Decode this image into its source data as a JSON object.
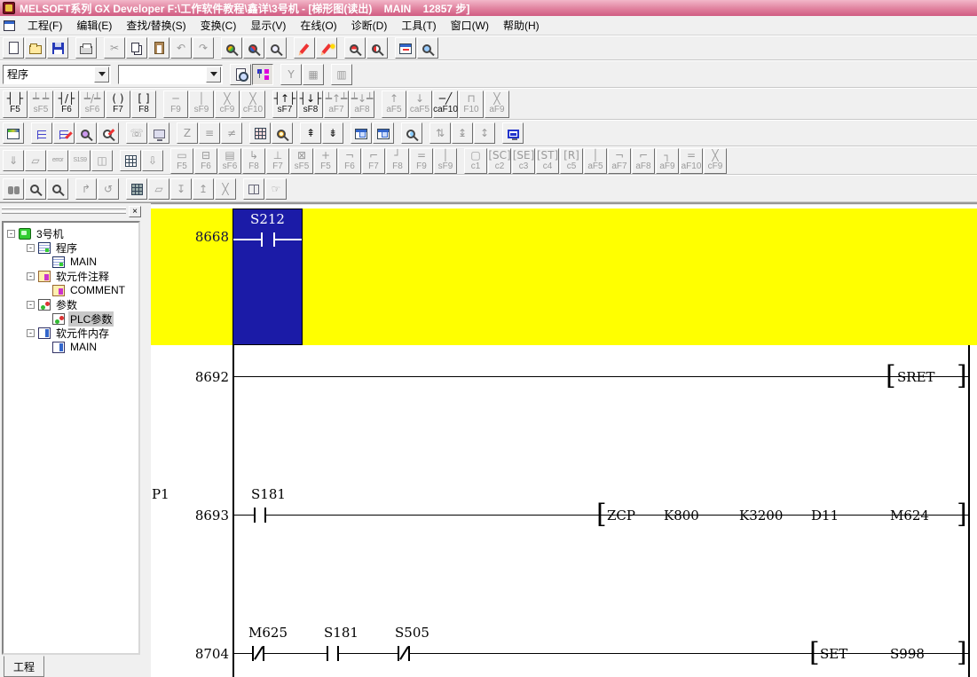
{
  "colors": {
    "titlebar_top": "#f2b7c9",
    "titlebar_mid": "#e0819e",
    "titlebar_bottom": "#d05c82",
    "end_yellow": "#ffff00",
    "selection_blue": "#1b1ba7",
    "tree_selected_bg": "#c8c8c8"
  },
  "title_bar": {
    "title": "MELSOFT系列 GX Developer F:\\工作软件教程\\鑫详\\3号机 - [梯形图(读出)    MAIN    12857 步]"
  },
  "menu": {
    "items": [
      "工程(F)",
      "编辑(E)",
      "查找/替换(S)",
      "变换(C)",
      "显示(V)",
      "在线(O)",
      "诊断(D)",
      "工具(T)",
      "窗口(W)",
      "帮助(H)"
    ]
  },
  "toolbars": {
    "row1": [
      {
        "name": "new-project-button",
        "cls": "i-page"
      },
      {
        "name": "open-project-button",
        "cls": "i-folder"
      },
      {
        "name": "save-project-button",
        "cls": "i-disk"
      },
      {
        "name": "print-button",
        "btncls": "sep",
        "cls": "i-printer"
      },
      {
        "name": "cut-button",
        "btncls": "gray sep",
        "cls": "i-glyph",
        "glyph": "✂"
      },
      {
        "name": "copy-button",
        "cls": "i-copy"
      },
      {
        "name": "paste-button",
        "btncls": "gray",
        "cls": "i-paste"
      },
      {
        "name": "undo-button",
        "btncls": "gray",
        "cls": "i-glyph",
        "glyph": "↶"
      },
      {
        "name": "redo-button",
        "btncls": "gray",
        "cls": "i-glyph",
        "glyph": "↷"
      },
      {
        "name": "find-device-button",
        "btncls": "sep",
        "cls": "i-mag mag-color"
      },
      {
        "name": "find-instruction-button",
        "cls": "i-mag mag-tri"
      },
      {
        "name": "find-string-button",
        "cls": "i-mag mag-abc"
      },
      {
        "name": "device-comment-edit-button",
        "btncls": "sep",
        "cls": "i-pencil"
      },
      {
        "name": "statement-edit-button",
        "cls": "i-pencil pencil-star"
      },
      {
        "name": "device-test-button",
        "btncls": "sep",
        "cls": "i-mag mag-dev"
      },
      {
        "name": "device-batch-monitor-button",
        "cls": "i-mag mag-dev2"
      },
      {
        "name": "transfer-setup-button",
        "btncls": "sep",
        "cls": "i-window win-transfer"
      },
      {
        "name": "program-monitor-button",
        "cls": "i-mag mag-check"
      }
    ],
    "program_combo_value": "程序",
    "find_combo_value": "",
    "row2_buttons": [
      {
        "name": "statement-list-button",
        "cls": "i-page page-mag"
      },
      {
        "name": "project-data-list-button",
        "btncls": "pressed",
        "cls": "i-tree"
      },
      {
        "name": "instruction-list-button",
        "btncls": "gray sep",
        "cls": "i-glyph",
        "glyph": "Y"
      },
      {
        "name": "device-use-list-button",
        "btncls": "gray",
        "cls": "i-glyph",
        "glyph": "▦"
      },
      {
        "name": "check-program-button",
        "btncls": "gray sep",
        "cls": "i-glyph",
        "glyph": "▥"
      }
    ],
    "row3": [
      {
        "name": "open-contact-button",
        "sym": "┤ ├",
        "label": "F5"
      },
      {
        "name": "parallel-open-contact-button",
        "btncls": "gray",
        "sym": "┷ ┷",
        "label": "sF5"
      },
      {
        "name": "closed-contact-button",
        "sym": "┤/├",
        "label": "F6"
      },
      {
        "name": "parallel-closed-contact-button",
        "btncls": "gray",
        "sym": "┷/┷",
        "label": "sF6"
      },
      {
        "name": "coil-button",
        "sym": "( )",
        "label": "F7"
      },
      {
        "name": "application-instruction-button",
        "sym": "[ ]",
        "label": "F8"
      },
      {
        "name": "horizontal-line-button",
        "btncls": "gray sep",
        "sym": "─",
        "label": "F9"
      },
      {
        "name": "vertical-line-button",
        "btncls": "gray",
        "sym": "│",
        "label": "sF9"
      },
      {
        "name": "delete-horizontal-line-button",
        "btncls": "gray",
        "sym": "╳",
        "label": "cF9"
      },
      {
        "name": "delete-vertical-line-button",
        "btncls": "gray",
        "sym": "╳",
        "label": "cF10"
      },
      {
        "name": "rising-pulse-button",
        "btncls": "sep",
        "sym": "┤↑├",
        "label": "sF7"
      },
      {
        "name": "falling-pulse-button",
        "sym": "┤↓├",
        "label": "sF8"
      },
      {
        "name": "parallel-rising-pulse-button",
        "btncls": "gray",
        "sym": "┷↑┷",
        "label": "aF7"
      },
      {
        "name": "parallel-falling-pulse-button",
        "btncls": "gray",
        "sym": "┷↓┷",
        "label": "aF8"
      },
      {
        "name": "rising-result-button",
        "btncls": "gray sep",
        "sym": "↑",
        "label": "aF5"
      },
      {
        "name": "falling-result-button",
        "btncls": "gray",
        "sym": "↓",
        "label": "caF5"
      },
      {
        "name": "invert-operation-button",
        "sym": "─╱",
        "label": "caF10"
      },
      {
        "name": "line-edit-button",
        "btncls": "gray",
        "sym": "⊓",
        "label": "F10"
      },
      {
        "name": "delete-line-button",
        "btncls": "gray",
        "sym": "╳",
        "label": "aF9"
      }
    ],
    "row4": [
      {
        "name": "ladder-logic-test-button",
        "cls": "i-window win-colored"
      },
      {
        "name": "comment-display-button",
        "btncls": "sep",
        "cls": "i-treelines"
      },
      {
        "name": "statement-display-button",
        "cls": "i-treelines tl-pencil"
      },
      {
        "name": "alias-display-button",
        "cls": "i-mag mag-purple"
      },
      {
        "name": "alias-edit-button",
        "cls": "i-mag mag-pencil"
      },
      {
        "name": "remote-operation-button",
        "btncls": "gray sep",
        "cls": "i-glyph",
        "glyph": "☏"
      },
      {
        "name": "monitor-test-button",
        "btncls": "gray",
        "cls": "i-monitor"
      },
      {
        "name": "sampling-trace-button",
        "btncls": "gray sep",
        "cls": "i-glyph",
        "glyph": "Z"
      },
      {
        "name": "entry-ladder-monitor-button",
        "btncls": "gray",
        "cls": "i-glyph",
        "glyph": "≡"
      },
      {
        "name": "delete-ladder-button",
        "btncls": "gray",
        "cls": "i-glyph",
        "glyph": "≠"
      },
      {
        "name": "device-memory-button",
        "btncls": "sep",
        "cls": "i-grid grid-color"
      },
      {
        "name": "clock-setting-button",
        "cls": "i-mag mag-clock"
      },
      {
        "name": "collapse-all-button",
        "btncls": "sep",
        "cls": "i-glyph",
        "glyph": "⇞"
      },
      {
        "name": "expand-all-button",
        "cls": "i-glyph",
        "glyph": "⇟"
      },
      {
        "name": "open-window-button",
        "btncls": "sep",
        "cls": "i-window win-arrow"
      },
      {
        "name": "open-reference-window-button",
        "cls": "i-window win-arrow2"
      },
      {
        "name": "online-program-change-button",
        "btncls": "sep",
        "cls": "i-mag mag-globe"
      },
      {
        "name": "insert-row-above-button",
        "btncls": "gray sep",
        "cls": "i-glyph",
        "glyph": "⇅"
      },
      {
        "name": "insert-row-below-button",
        "btncls": "gray",
        "cls": "i-glyph",
        "glyph": "↨"
      },
      {
        "name": "delete-row-button",
        "btncls": "gray",
        "cls": "i-glyph",
        "glyph": "↕"
      },
      {
        "name": "ladder-monitor-button",
        "btncls": "sep",
        "cls": "i-monitor mon-blue"
      }
    ],
    "row5_left": [
      {
        "name": "step-execute-button",
        "btncls": "gray",
        "cls": "i-glyph",
        "glyph": "⇓"
      },
      {
        "name": "cascade-windows-button",
        "btncls": "gray",
        "cls": "i-glyph",
        "glyph": "▱"
      },
      {
        "name": "error-list-button",
        "btncls": "gray",
        "cls": "i-error",
        "glyph": "error"
      },
      {
        "name": "step-number-button",
        "btncls": "gray",
        "cls": "i-error",
        "glyph": "S1S9"
      },
      {
        "name": "block-list-button",
        "btncls": "gray",
        "cls": "i-glyph",
        "glyph": "◫"
      },
      {
        "name": "sfc-grid-button",
        "btncls": "sep",
        "cls": "i-grid"
      },
      {
        "name": "block-down-button",
        "btncls": "gray",
        "cls": "i-glyph",
        "glyph": "⇩"
      }
    ],
    "row5_sfc": [
      {
        "name": "sfc-step-button",
        "btncls": "gray sep",
        "sym": "▭",
        "label": "F5"
      },
      {
        "name": "sfc-block-start-step-button",
        "btncls": "gray",
        "sym": "⊟",
        "label": "F6"
      },
      {
        "name": "sfc-end-step-button",
        "btncls": "gray",
        "sym": "▤",
        "label": "sF6"
      },
      {
        "name": "sfc-jump-button",
        "btncls": "gray",
        "sym": "↳",
        "label": "F8"
      },
      {
        "name": "sfc-transition-button",
        "btncls": "gray",
        "sym": "⊥",
        "label": "F7"
      },
      {
        "name": "sfc-dummy-step-button",
        "btncls": "gray",
        "sym": "⊠",
        "label": "sF5"
      },
      {
        "name": "sfc-vertical-line-button",
        "btncls": "gray",
        "sym": "+",
        "label": "F5"
      },
      {
        "name": "sfc-selection-divergence-button",
        "btncls": "gray",
        "sym": "¬",
        "label": "F6"
      },
      {
        "name": "sfc-simultaneous-divergence-button",
        "btncls": "gray",
        "sym": "⌐",
        "label": "F7"
      },
      {
        "name": "sfc-selection-convergence-button",
        "btncls": "gray",
        "sym": "┘",
        "label": "F8"
      },
      {
        "name": "sfc-simultaneous-convergence-button",
        "btncls": "gray",
        "sym": "=",
        "label": "F9"
      },
      {
        "name": "sfc-line-button",
        "btncls": "gray",
        "sym": "│",
        "label": "sF9"
      }
    ],
    "row5_c": [
      {
        "name": "sfc-c1-button",
        "btncls": "gray sep",
        "sym": "▢",
        "label": "c1"
      },
      {
        "name": "sfc-sc-button",
        "btncls": "gray",
        "sym": "[SC]",
        "label": "c2"
      },
      {
        "name": "sfc-se-button",
        "btncls": "gray",
        "sym": "[SE]",
        "label": "c3"
      },
      {
        "name": "sfc-st-button",
        "btncls": "gray",
        "sym": "[ST]",
        "label": "c4"
      },
      {
        "name": "sfc-r-button",
        "btncls": "gray",
        "sym": "[R]",
        "label": "c5"
      },
      {
        "name": "sfc-af5-button",
        "btncls": "gray",
        "sym": "│",
        "label": "aF5"
      },
      {
        "name": "sfc-af7-button",
        "btncls": "gray",
        "sym": "¬",
        "label": "aF7"
      },
      {
        "name": "sfc-af8-button",
        "btncls": "gray",
        "sym": "⌐",
        "label": "aF8"
      },
      {
        "name": "sfc-af9-button",
        "btncls": "gray",
        "sym": "┐",
        "label": "aF9"
      },
      {
        "name": "sfc-af10-button",
        "btncls": "gray",
        "sym": "=",
        "label": "aF10"
      },
      {
        "name": "sfc-delete-button",
        "btncls": "gray",
        "sym": "╳",
        "label": "cF9"
      }
    ],
    "row6": [
      {
        "name": "find-button",
        "btncls": "gray",
        "cls": "i-binoc"
      },
      {
        "name": "find-next-button",
        "btncls": "gray",
        "cls": "i-mag mag-down"
      },
      {
        "name": "find-previous-button",
        "btncls": "gray",
        "cls": "i-mag mag-up"
      },
      {
        "name": "jump-button",
        "btncls": "gray sep",
        "cls": "i-glyph",
        "glyph": "↱"
      },
      {
        "name": "jump-history-button",
        "btncls": "gray",
        "cls": "i-glyph",
        "glyph": "↺"
      },
      {
        "name": "block-monitor-button",
        "btncls": "sep",
        "cls": "i-grid2"
      },
      {
        "name": "cascade-button",
        "btncls": "gray",
        "cls": "i-glyph",
        "glyph": "▱"
      },
      {
        "name": "line-statement-down-button",
        "btncls": "gray",
        "cls": "i-glyph",
        "glyph": "↧"
      },
      {
        "name": "line-statement-up-button",
        "btncls": "gray",
        "cls": "i-glyph",
        "glyph": "↥"
      },
      {
        "name": "line-statement-delete-button",
        "btncls": "gray",
        "cls": "i-glyph",
        "glyph": "╳"
      },
      {
        "name": "registered-device-button",
        "btncls": "gray sep",
        "cls": "i-book"
      },
      {
        "name": "scroll-hand-button",
        "btncls": "gray",
        "cls": "i-glyph",
        "glyph": "☞"
      }
    ]
  },
  "project_tree": {
    "close_icon": "×",
    "tab_label": "工程",
    "items": [
      {
        "name": "tree-item-project-root",
        "cls": "lvl0",
        "exp": "-",
        "icon": "ic-root",
        "label": "3号机"
      },
      {
        "name": "tree-item-program-folder",
        "cls": "lvl1",
        "exp": "-",
        "icon": "ic-prog",
        "label": "程序"
      },
      {
        "name": "tree-item-program-main",
        "cls": "lvl2 leaf",
        "exp": "",
        "icon": "ic-prog",
        "label": "MAIN"
      },
      {
        "name": "tree-item-comment-folder",
        "cls": "lvl1",
        "exp": "-",
        "icon": "ic-cmt",
        "label": "软元件注释"
      },
      {
        "name": "tree-item-comment",
        "cls": "lvl2 leaf",
        "exp": "",
        "icon": "ic-cmt",
        "label": "COMMENT"
      },
      {
        "name": "tree-item-parameter-folder",
        "cls": "lvl1",
        "exp": "-",
        "icon": "ic-param",
        "label": "参数"
      },
      {
        "name": "tree-item-plc-parameter",
        "cls": "lvl2 leaf selected",
        "exp": "",
        "icon": "ic-param",
        "label": "PLC参数"
      },
      {
        "name": "tree-item-device-memory-folder",
        "cls": "lvl1",
        "exp": "-",
        "icon": "ic-mem",
        "label": "软元件内存"
      },
      {
        "name": "tree-item-device-memory-main",
        "cls": "lvl2 leaf",
        "exp": "",
        "icon": "ic-mem",
        "label": "MAIN"
      }
    ]
  },
  "ladder": {
    "end": {
      "number": "8668",
      "contact_label": "S212"
    },
    "r1": {
      "number": "8692",
      "lb": "[",
      "op": "SRET",
      "rb": "]"
    },
    "r2": {
      "pointer": "P1",
      "number": "8693",
      "c1": "S181",
      "lb": "[",
      "op": "ZCP",
      "o1": "K800",
      "o2": "K3200",
      "o3": "D11",
      "o4": "M624",
      "rb": "]"
    },
    "r3": {
      "number": "8704",
      "c1": "M625",
      "c2": "S181",
      "c3": "S505",
      "lb": "[",
      "op": "SET",
      "o1": "S998",
      "rb": "]"
    }
  }
}
